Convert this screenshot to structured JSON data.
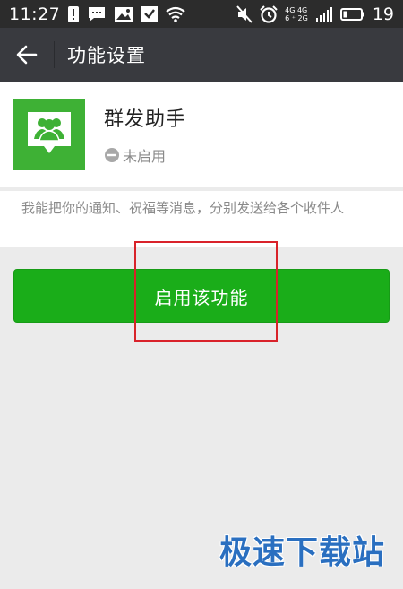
{
  "status_bar": {
    "time": "11:27",
    "network_top": "4G 4G",
    "network_bottom": "6 ⁺ 2G",
    "battery": "19"
  },
  "title_bar": {
    "title": "功能设置",
    "back_icon": "arrow-left-icon"
  },
  "feature": {
    "name": "群发助手",
    "status": "未启用",
    "icon": "group-chat-icon",
    "icon_color": "#3eb135",
    "description": "我能把你的通知、祝福等消息，分别发送给各个收件人"
  },
  "enable_button": {
    "label": "启用该功能",
    "color": "#1aad19"
  },
  "annotation": {
    "color": "#d9222a"
  },
  "watermark": {
    "text": "极速下载站",
    "color": "#2a6fc0"
  }
}
